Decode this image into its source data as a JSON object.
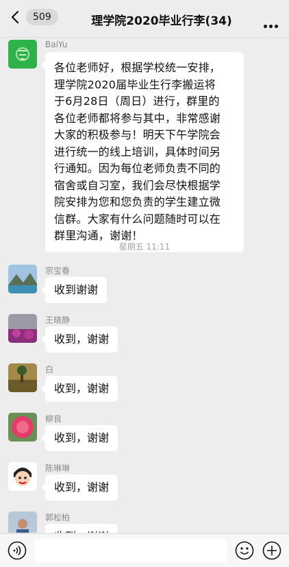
{
  "header": {
    "unread_count": "509",
    "title": "理学院2020毕业行李(34)"
  },
  "messages": [
    {
      "sender": "BaiYu",
      "lines": [
        "各位老师好，根据学校统一安排，",
        "理学院2020届毕业生行李搬运将",
        "于6月28日（周日）进行，群里的",
        "各位老师都将参与其中，非常感谢",
        "大家的积极参与！明天下午学院会",
        "进行统一的线上培训，具体时间另",
        "行通知。因为每位老师负责不同的",
        "宿舍或自习室，我们会尽快根据学",
        "院安排为您和您负责的学生建立微",
        "信群。大家有什么问题随时可以在",
        "群里沟通，谢谢！"
      ]
    },
    {
      "sender": "宗宝春",
      "text": "收到谢谢"
    },
    {
      "sender": "王晓静",
      "text": "收到，谢谢"
    },
    {
      "sender": "白",
      "text": "收到，谢谢"
    },
    {
      "sender": "柳良",
      "text": "收到，谢谢"
    },
    {
      "sender": "陈琳琳",
      "text": "收到，谢谢"
    },
    {
      "sender": "郭松柏",
      "text": "收到，谢谢"
    }
  ],
  "timestamp": "星期五 11:11",
  "icons": {
    "back": "chevron-left-icon",
    "more": "more-dots-icon",
    "voice": "voice-icon",
    "emoji": "emoji-icon",
    "plus": "plus-icon"
  },
  "colors": {
    "background": "#ededed",
    "bubble": "#ffffff",
    "muted_text": "#8a8a8a"
  }
}
